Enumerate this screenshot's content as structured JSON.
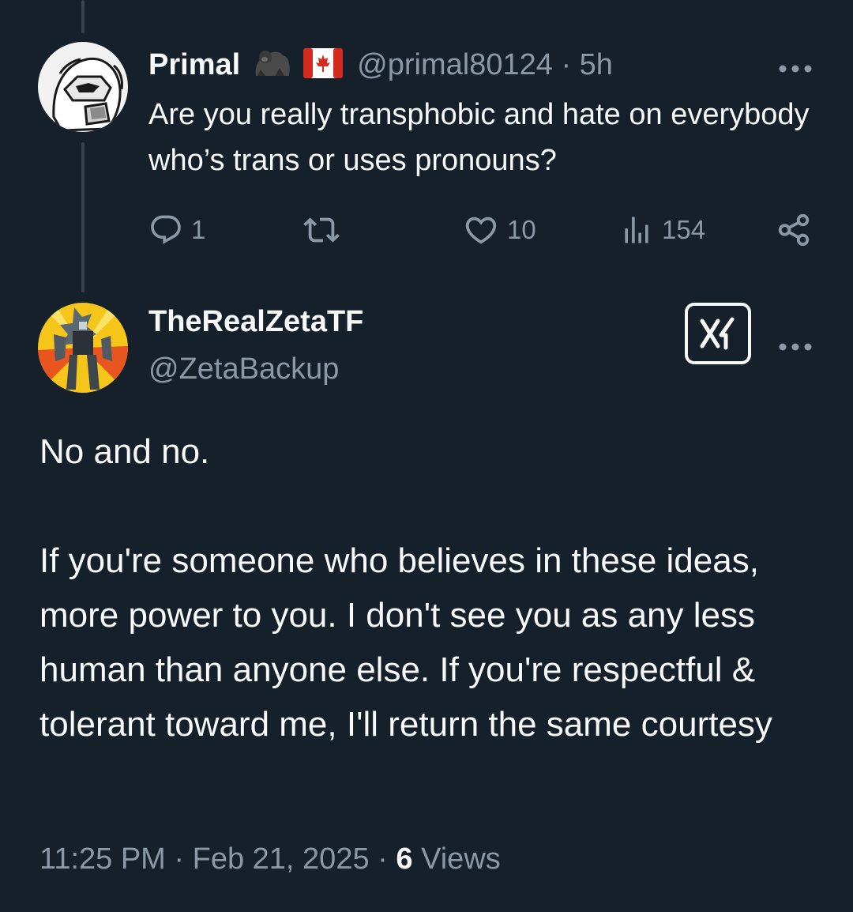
{
  "reply": {
    "display_name": "Primal",
    "emoji_1": "gorilla-emoji",
    "emoji_2": "canada-flag-emoji",
    "handle": "@primal80124",
    "separator": "·",
    "time": "5h",
    "text": "Are you really transphobic and hate on everybody who’s trans or uses pronouns?",
    "more_icon": "more-dots-icon",
    "actions": {
      "reply_count": "1",
      "retweet_count": "",
      "like_count": "10",
      "view_count": "154"
    }
  },
  "tweet": {
    "display_name": "TheRealZetaTF",
    "handle": "@ZetaBackup",
    "grok_icon": "grok-icon",
    "more_icon": "more-dots-icon",
    "paragraph_1": "No and no.",
    "paragraph_2": "If you're someone who believes in these ideas, more power to you. I don't see you as any less human than anyone else. If you're respectful & tolerant toward me, I'll return the same courtesy",
    "time": "11:25 PM",
    "separator": "·",
    "date": "Feb 21, 2025",
    "views_count": "6",
    "views_label": "Views"
  },
  "colors": {
    "background": "#15202b",
    "primary_text": "#f7f9f9",
    "secondary_text": "#8b98a5",
    "thread_line": "#38444d",
    "canada_red": "#d52b1e"
  }
}
